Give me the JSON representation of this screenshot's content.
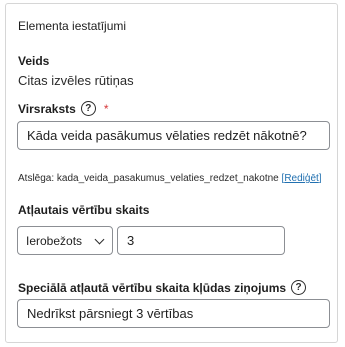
{
  "panel": {
    "title": "Elementa iestatījumi"
  },
  "type_field": {
    "label": "Veids",
    "value": "Citas izvēles rūtiņas"
  },
  "heading_field": {
    "label": "Virsraksts",
    "help_icon": "?",
    "required_mark": "*",
    "value": "Kāda veida pasākumus vēlaties redzēt nākotnē?"
  },
  "key_info": {
    "prefix": "Atslēga: ",
    "key": "kada_veida_pasakumus_velaties_redzet_nakotne",
    "edit_open": "[",
    "edit_label": "Rediģēt",
    "edit_close": "]"
  },
  "allowed_count": {
    "label": "Atļautais vērtību skaits",
    "select_value": "Ierobežots",
    "number_value": "3"
  },
  "error_message": {
    "label": "Speciālā atļautā vērtību skaita kļūdas ziņojums",
    "help_icon": "?",
    "value": "Nedrīkst pārsniegt 3 vērtības"
  },
  "icons": {
    "help": "question-circle-icon",
    "dropdown": "chevron-down-icon"
  },
  "colors": {
    "link": "#2271b1",
    "required": "#d63638",
    "border": "#8c8f94"
  }
}
